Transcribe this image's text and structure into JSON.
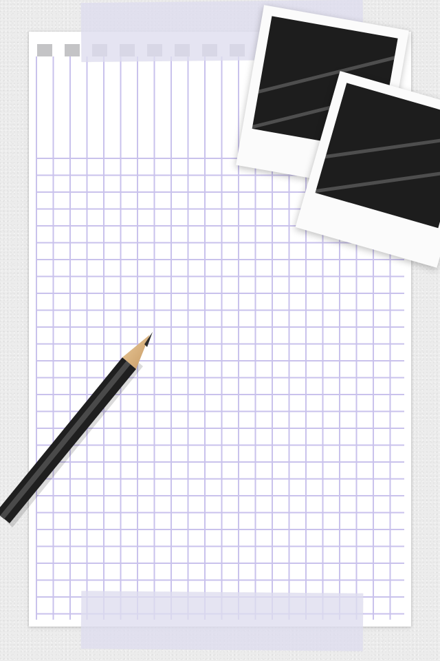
{
  "scene": {
    "background_color": "#ececec",
    "paper_color": "#ffffff",
    "grid_color": "#c9c2ec",
    "tape_color": "#dedcee",
    "photo_fill_color": "#1d1d1d",
    "pencil_color": "#1f1f1f"
  },
  "objects": {
    "notebook_page": "grid-paper-icon",
    "pencil": "pencil-icon",
    "photos": [
      "photo-frame-icon",
      "photo-frame-icon"
    ],
    "tapes": [
      "tape-icon",
      "tape-icon"
    ]
  }
}
